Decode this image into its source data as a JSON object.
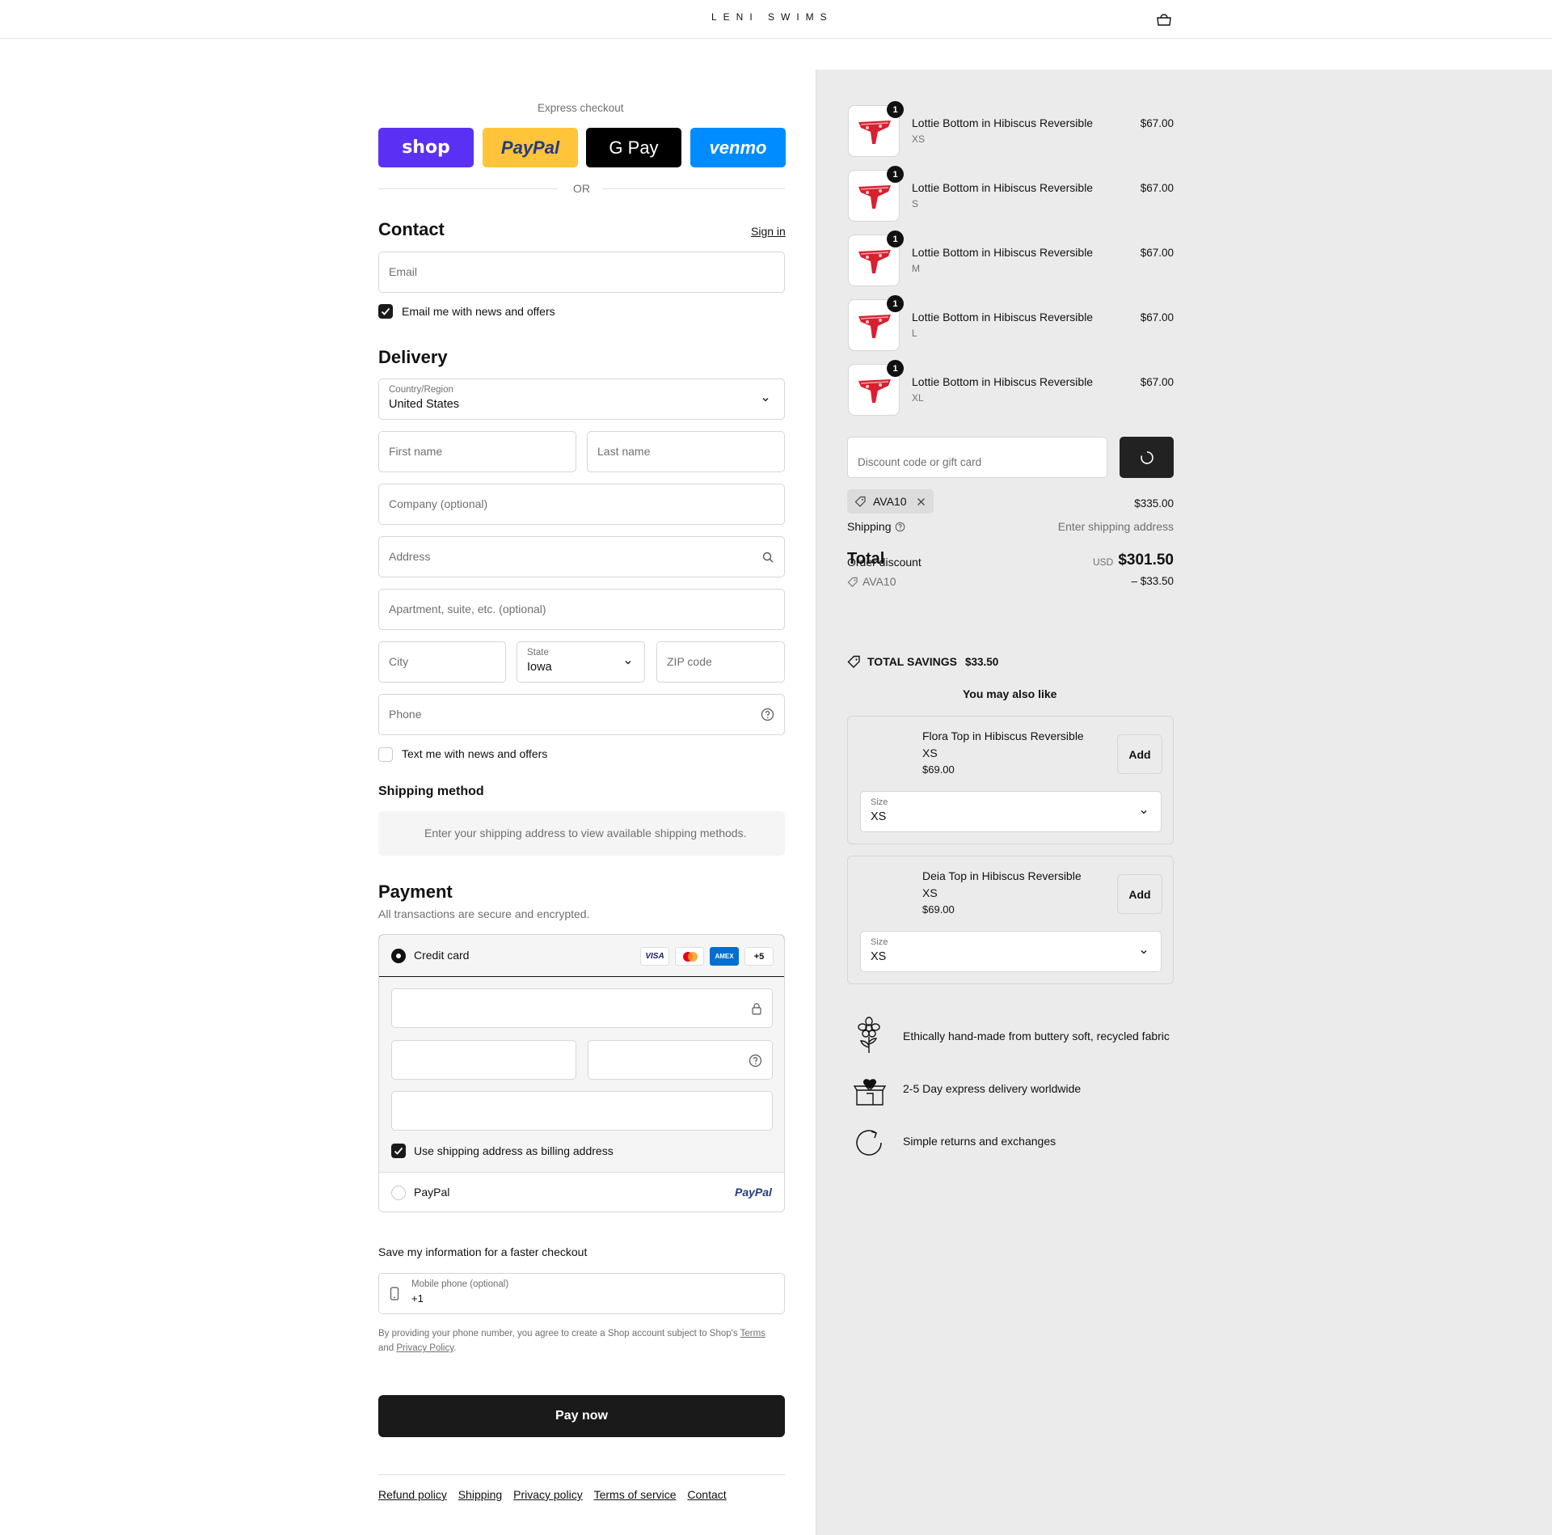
{
  "header": {
    "logo": "LENI SWIMS",
    "cart_icon": "shopping-bag-icon"
  },
  "express": {
    "title": "Express checkout",
    "buttons": [
      {
        "label": "shop",
        "color": "#5a31f4"
      },
      {
        "label": "PayPal",
        "color": "#ffc439"
      },
      {
        "label": "G Pay",
        "color": "#000000"
      },
      {
        "label": "venmo",
        "color": "#008cff"
      }
    ],
    "or": "OR"
  },
  "contact": {
    "title": "Contact",
    "sign_in": "Sign in",
    "email_placeholder": "Email",
    "news_label": "Email me with news and offers"
  },
  "delivery": {
    "title": "Delivery",
    "country_label": "Country/Region",
    "country_value": "United States",
    "first_name": "First name",
    "last_name": "Last name",
    "company": "Company (optional)",
    "address": "Address",
    "apartment": "Apartment, suite, etc. (optional)",
    "city": "City",
    "state_label": "State",
    "state_value": "Iowa",
    "zip": "ZIP code",
    "phone": "Phone",
    "text_label": "Text me with news and offers"
  },
  "shipping_method": {
    "title": "Shipping method",
    "message": "Enter your shipping address to view available shipping methods."
  },
  "payment": {
    "title": "Payment",
    "subtitle": "All transactions are secure and encrypted.",
    "credit_card": "Credit card",
    "card_brands": [
      "VISA",
      "MC",
      "AMEX",
      "+5"
    ],
    "billing_label": "Use shipping address as billing address",
    "paypal": "PayPal",
    "paypal_logo": "PayPal"
  },
  "save_info": {
    "title": "Save my information for a faster checkout",
    "mobile_label": "Mobile phone (optional)",
    "mobile_value": "+1",
    "legal_1": "By providing your phone number, you agree to create a Shop account subject to Shop's",
    "terms": "Terms",
    "and": "and",
    "privacy": "Privacy Policy",
    "period": "."
  },
  "pay_now": "Pay now",
  "footer_links": [
    "Refund policy",
    "Shipping",
    "Privacy policy",
    "Terms of service",
    "Contact"
  ],
  "summary": {
    "items": [
      {
        "name": "Lottie Bottom in Hibiscus Reversible",
        "variant": "XS",
        "price": "$67.00",
        "qty": "1"
      },
      {
        "name": "Lottie Bottom in Hibiscus Reversible",
        "variant": "S",
        "price": "$67.00",
        "qty": "1"
      },
      {
        "name": "Lottie Bottom in Hibiscus Reversible",
        "variant": "M",
        "price": "$67.00",
        "qty": "1"
      },
      {
        "name": "Lottie Bottom in Hibiscus Reversible",
        "variant": "L",
        "price": "$67.00",
        "qty": "1"
      },
      {
        "name": "Lottie Bottom in Hibiscus Reversible",
        "variant": "XL",
        "price": "$67.00",
        "qty": "1"
      }
    ],
    "discount_placeholder": "Discount code or gift card",
    "applied_code": "AVA10",
    "subtotal": "$335.00",
    "shipping_label": "Shipping",
    "shipping_value": "Enter shipping address",
    "order_discount_label": "Order discount",
    "total_label": "Total",
    "currency": "USD",
    "total_value": "$301.50",
    "discount_code": "AVA10",
    "discount_value": "– $33.50",
    "savings_label": "TOTAL SAVINGS",
    "savings_value": "$33.50",
    "upsell_title": "You may also like",
    "upsells": [
      {
        "name": "Flora Top in Hibiscus Reversible",
        "variant": "XS",
        "price": "$69.00",
        "add": "Add",
        "size_label": "Size",
        "size_value": "XS"
      },
      {
        "name": "Deia Top in Hibiscus Reversible",
        "variant": "XS",
        "price": "$69.00",
        "add": "Add",
        "size_label": "Size",
        "size_value": "XS"
      }
    ],
    "features": [
      {
        "icon": "flower-icon",
        "text": "Ethically hand-made from buttery soft, recycled fabric"
      },
      {
        "icon": "gift-box-heart-icon",
        "text": "2-5 Day express delivery worldwide"
      },
      {
        "icon": "returns-arrow-icon",
        "text": "Simple returns and exchanges"
      }
    ]
  }
}
